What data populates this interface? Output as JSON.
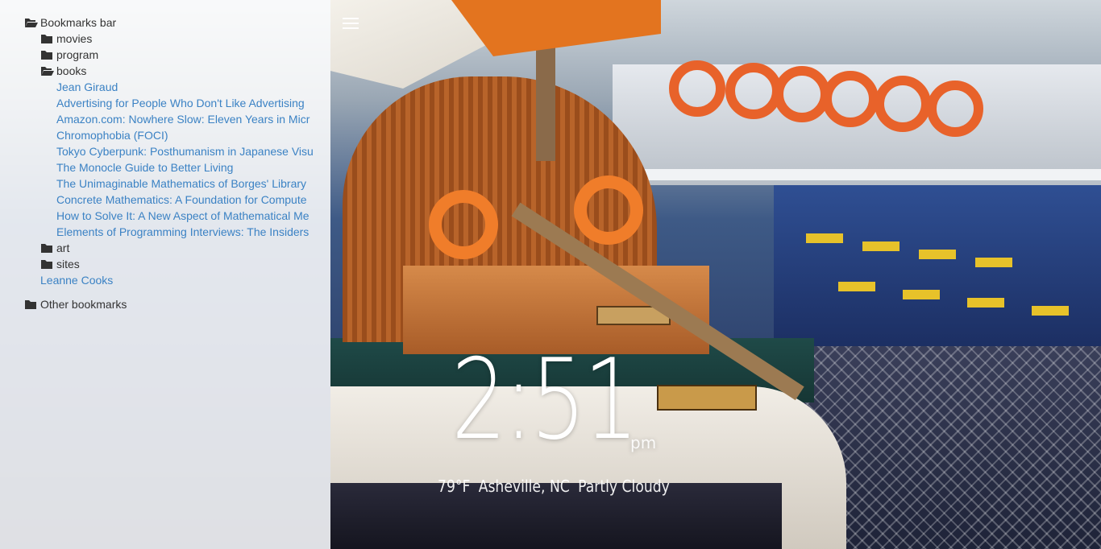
{
  "bookmarks": {
    "bar_label": "Bookmarks bar",
    "folders": {
      "movies": "movies",
      "program": "program",
      "books": "books",
      "art": "art",
      "sites": "sites"
    },
    "books_links": [
      "Jean Giraud",
      "Advertising for People Who Don't Like Advertising",
      "Amazon.com: Nowhere Slow: Eleven Years in Micr",
      "Chromophobia (FOCI)",
      "Tokyo Cyberpunk: Posthumanism in Japanese Visu",
      "The Monocle Guide to Better Living",
      "The Unimaginable Mathematics of Borges' Library",
      "Concrete Mathematics: A Foundation for Compute",
      "How to Solve It: A New Aspect of Mathematical Me",
      "Elements of Programming Interviews: The Insiders"
    ],
    "bar_link": "Leanne Cooks",
    "other_label": "Other bookmarks"
  },
  "clock": {
    "time": "2:51",
    "ampm": "pm"
  },
  "weather": {
    "temp": "79°F",
    "location": "Asheville, NC",
    "condition": "Partly Cloudy"
  },
  "colors": {
    "link": "#3b82c4",
    "folder_text": "#333333",
    "panel_bg": "rgba(255,255,255,0.86)"
  },
  "icons": {
    "folder_open": "folder-open-icon",
    "folder_closed": "folder-icon",
    "menu": "hamburger-menu-icon"
  }
}
